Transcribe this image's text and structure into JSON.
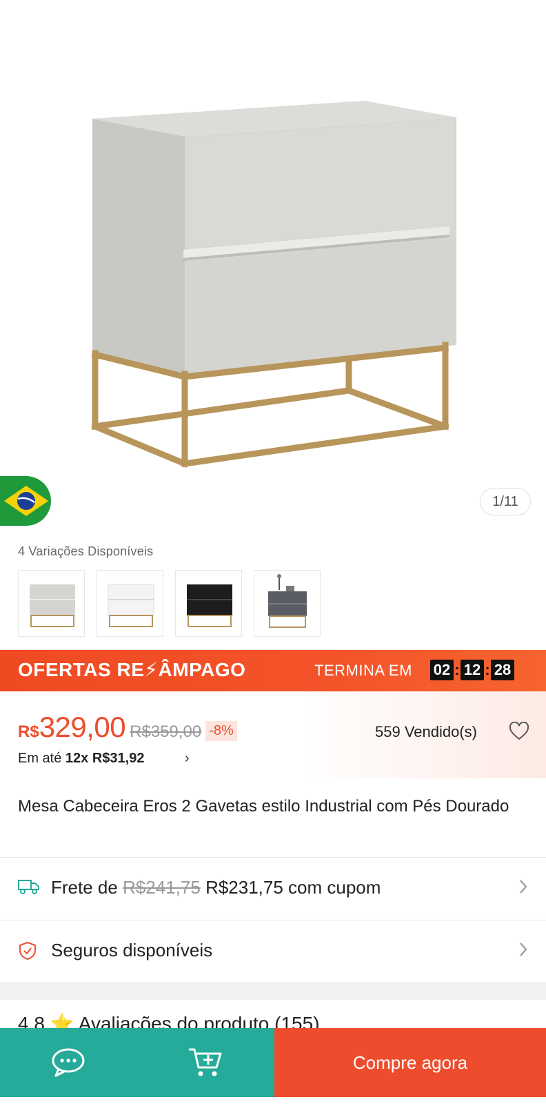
{
  "gallery": {
    "counter": "1/11",
    "flag": "brazil-flag"
  },
  "variations": {
    "label": "4 Variações Disponíveis",
    "items": [
      {
        "name": "light-gray"
      },
      {
        "name": "white"
      },
      {
        "name": "black"
      },
      {
        "name": "dark-gray-decorated"
      }
    ]
  },
  "flash_sale": {
    "title": "OFERTAS RE⚡ÂMPAGO",
    "ends_label": "TERMINA EM",
    "hours": "02",
    "minutes": "12",
    "seconds": "28"
  },
  "price": {
    "currency": "R$",
    "current": "329,00",
    "original": "R$359,00",
    "discount": "-8%",
    "sold": "559 Vendido(s)",
    "installments_prefix": "Em até",
    "installments_value": "12x R$31,92",
    "installments_chevron": "›"
  },
  "product": {
    "title": "Mesa Cabeceira Eros 2 Gavetas estilo Industrial com Pés Dourado"
  },
  "shipping": {
    "prefix": "Frete de",
    "original": "R$241,75",
    "discounted": "R$231,75 com cupom"
  },
  "insurance": {
    "label": "Seguros disponíveis"
  },
  "rating_peek": {
    "text": "4.8 ⭐ Avaliações do produto (155)"
  },
  "bottom_bar": {
    "buy_label": "Compre agora"
  },
  "colors": {
    "accent": "#ee4d2d",
    "teal": "#26aa99",
    "gold": "#b8955a"
  }
}
